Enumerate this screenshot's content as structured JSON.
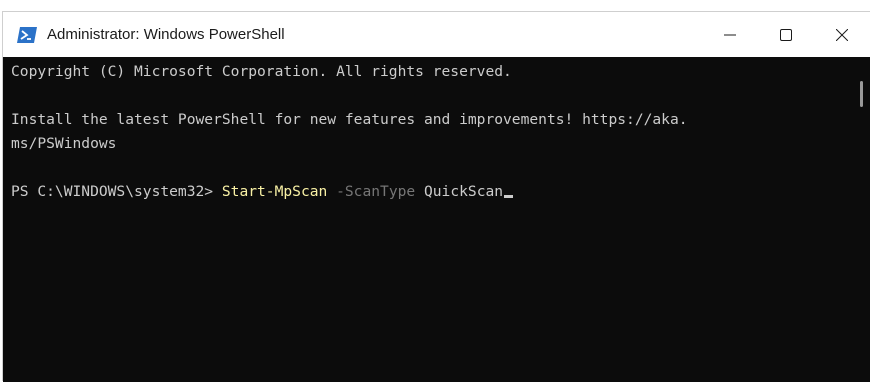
{
  "window": {
    "title": "Administrator: Windows PowerShell",
    "icon": "powershell-icon",
    "controls": [
      "minimize-icon",
      "maximize-icon",
      "close-icon"
    ]
  },
  "console": {
    "lines": [
      "Copyright (C) Microsoft Corporation. All rights reserved.",
      "",
      "Install the latest PowerShell for new features and improvements! https://aka.",
      "ms/PSWindows",
      ""
    ],
    "prompt": "PS C:\\WINDOWS\\system32> ",
    "command": {
      "cmdlet": "Start-MpScan",
      "parameter": " -ScanType",
      "argument": " QuickScan"
    }
  },
  "colors": {
    "console_background": "#0c0c0c",
    "console_text": "#cccccc",
    "cmdlet": "#f9f1a5",
    "parameter": "#767676",
    "titlebar": "#ffffff"
  }
}
